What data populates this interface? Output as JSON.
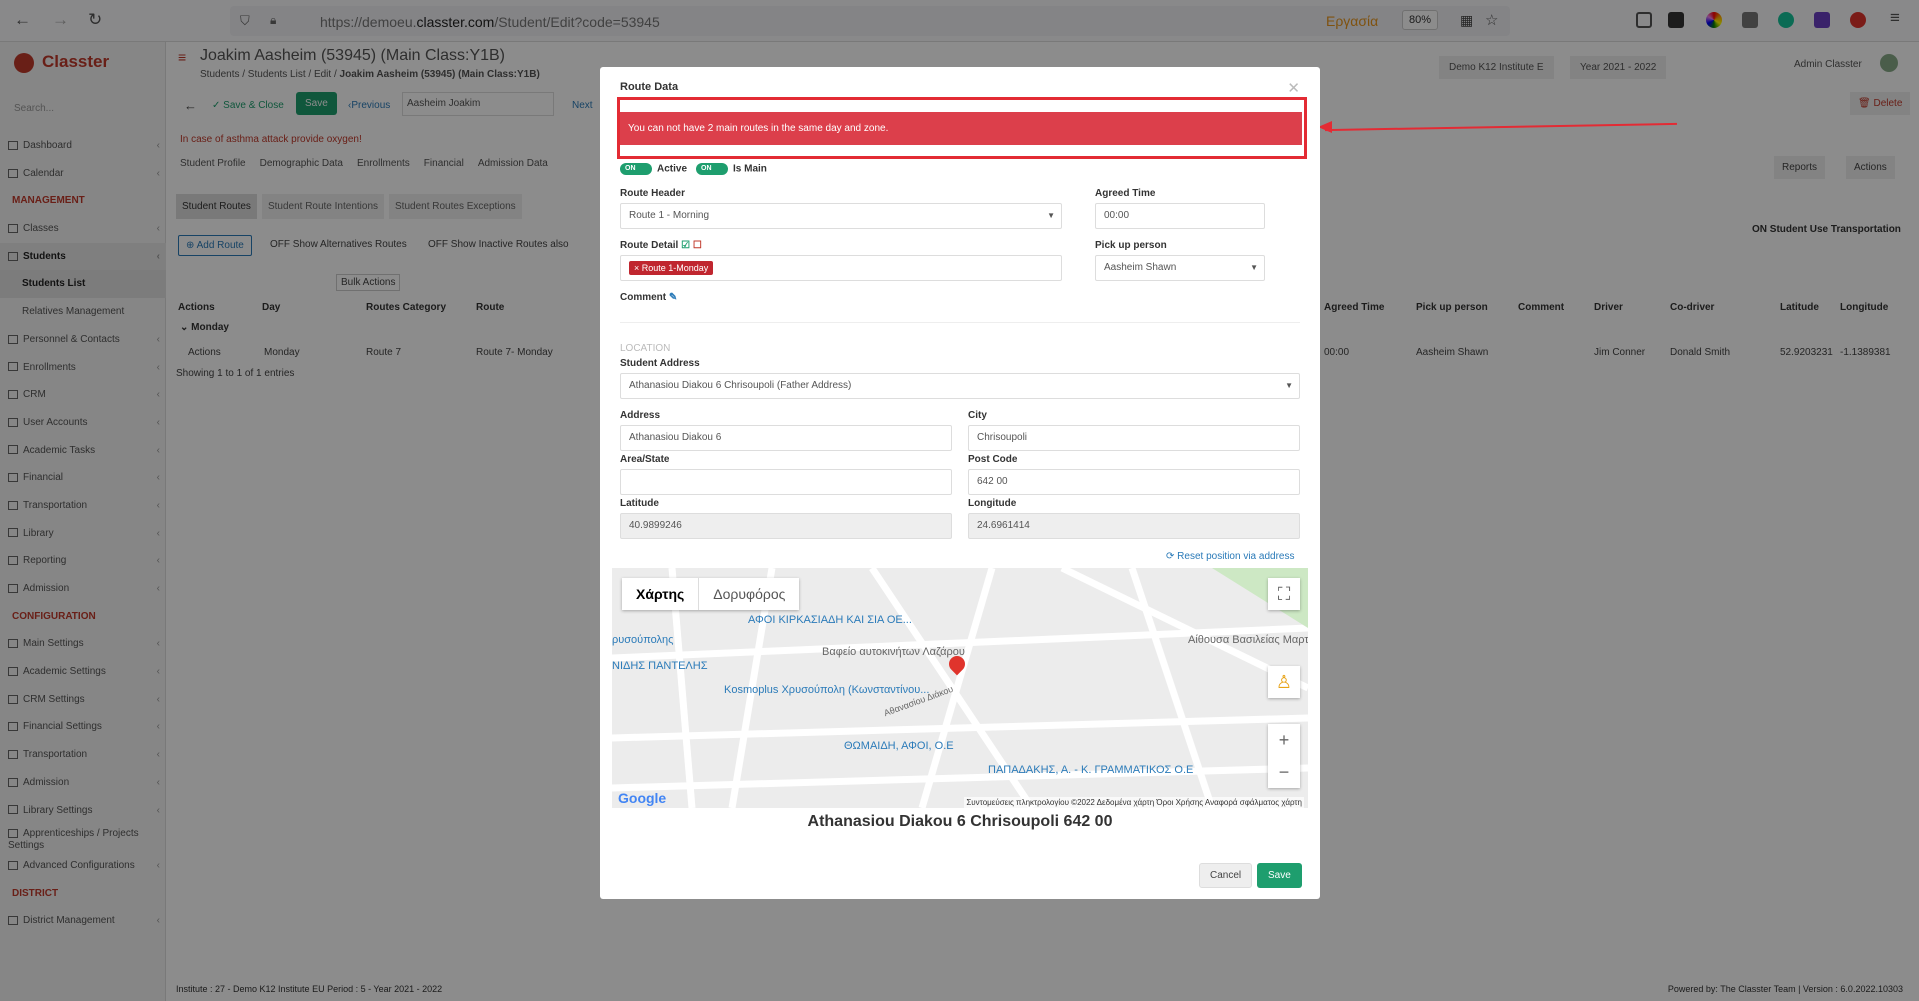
{
  "browser": {
    "url_prefix": "https://demoeu.",
    "url_domain": "classter.com",
    "url_path": "/Student/Edit?code=53945",
    "container": "Εργασία",
    "zoom": "80%"
  },
  "app": {
    "logo": "Classter",
    "search_placeholder": "Search..."
  },
  "nav": [
    {
      "label": "Dashboard",
      "type": "item"
    },
    {
      "label": "Calendar",
      "type": "item"
    },
    {
      "label": "MANAGEMENT",
      "type": "sec"
    },
    {
      "label": "Classes",
      "type": "item"
    },
    {
      "label": "Students",
      "type": "act"
    },
    {
      "label": "Students List",
      "type": "subact"
    },
    {
      "label": "Relatives Management",
      "type": "sub"
    },
    {
      "label": "Personnel & Contacts",
      "type": "item"
    },
    {
      "label": "Enrollments",
      "type": "item"
    },
    {
      "label": "CRM",
      "type": "item"
    },
    {
      "label": "User Accounts",
      "type": "item"
    },
    {
      "label": "Academic Tasks",
      "type": "item"
    },
    {
      "label": "Financial",
      "type": "item"
    },
    {
      "label": "Transportation",
      "type": "item"
    },
    {
      "label": "Library",
      "type": "item"
    },
    {
      "label": "Reporting",
      "type": "item"
    },
    {
      "label": "Admission",
      "type": "item"
    },
    {
      "label": "CONFIGURATION",
      "type": "sec"
    },
    {
      "label": "Main Settings",
      "type": "item"
    },
    {
      "label": "Academic Settings",
      "type": "item"
    },
    {
      "label": "CRM Settings",
      "type": "item"
    },
    {
      "label": "Financial Settings",
      "type": "item"
    },
    {
      "label": "Transportation",
      "type": "item"
    },
    {
      "label": "Admission",
      "type": "item"
    },
    {
      "label": "Library Settings",
      "type": "item"
    },
    {
      "label": "Apprenticeships / Projects Settings",
      "type": "wrap"
    },
    {
      "label": "Advanced Configurations",
      "type": "item"
    },
    {
      "label": "DISTRICT",
      "type": "sec"
    },
    {
      "label": "District Management",
      "type": "item"
    }
  ],
  "header": {
    "title": "Joakim Aasheim (53945) (Main Class:Y1B)",
    "crumbs": "Students / Students List / Edit /",
    "crumb_current": "Joakim Aasheim (53945) (Main Class:Y1B)",
    "institute": "Demo K12 Institute E",
    "year": "Year 2021 - 2022",
    "admin": "Admin Classter"
  },
  "toolbar": {
    "save_close": "Save & Close",
    "save": "Save",
    "previous": "Previous",
    "student": "Aasheim Joakim",
    "next": "Next",
    "delete": "Delete",
    "reports": "Reports",
    "actions": "Actions"
  },
  "asthma": "In case of asthma attack provide oxygen!",
  "tabs": [
    "Student Profile",
    "Demographic Data",
    "Enrollments",
    "Financial",
    "Admission Data"
  ],
  "subtabs": [
    "Student Routes",
    "Student Route Intentions",
    "Student Routes Exceptions"
  ],
  "route_tools": {
    "add_route": "Add Route",
    "show_alt": "Show Alternatives Routes",
    "show_inactive": "Show Inactive Routes also",
    "bulk": "Bulk Actions",
    "use_transport": "Student Use Transportation",
    "off": "OFF",
    "on": "ON"
  },
  "table": {
    "left_headers": [
      "Actions",
      "Day",
      "Routes Category",
      "Route"
    ],
    "right_headers": [
      "Agreed Time",
      "Pick up person",
      "Comment",
      "Driver",
      "Co-driver",
      "Latitude",
      "Longitude"
    ],
    "group": "Monday",
    "row": {
      "actions": "Actions",
      "day": "Monday",
      "category": "Route 7",
      "route": "Route 7- Monday",
      "agreed": "00:00",
      "pickup": "Aasheim Shawn",
      "driver": "Jim Conner",
      "codriver": "Donald Smith",
      "lat": "52.9203231",
      "lng": "-1.1389381"
    },
    "showing": "Showing 1 to 1 of 1 entries"
  },
  "modal": {
    "title": "Route Data",
    "error": "You can not have 2 main routes in the same day and zone.",
    "active": "Active",
    "is_main": "Is Main",
    "on": "ON",
    "route_header_label": "Route Header",
    "route_header": "Route 1 - Morning",
    "agreed_label": "Agreed Time",
    "agreed": "00:00",
    "route_detail_label": "Route Detail",
    "route_detail_chip": "Route 1-Monday",
    "pickup_label": "Pick up person",
    "pickup": "Aasheim Shawn",
    "comment_label": "Comment",
    "location": "LOCATION",
    "student_address_label": "Student Address",
    "student_address": "Athanasiou Diakou 6 Chrisoupoli (Father Address)",
    "address_label": "Address",
    "address": "Athanasiou Diakou 6",
    "city_label": "City",
    "city": "Chrisoupoli",
    "area_label": "Area/State",
    "area": "",
    "post_label": "Post Code",
    "post": "642 00",
    "lat_label": "Latitude",
    "lat": "40.9899246",
    "lng_label": "Longitude",
    "lng": "24.6961414",
    "reset": "Reset position via address",
    "map_type_map": "Χάρτης",
    "map_type_sat": "Δορυφόρος",
    "map_labels": [
      "ΑΦΟΙ ΚΙΡΚΑΣΙΑΔΗ ΚΑΙ ΣΙΑ ΟΕ...",
      "Βαφείο αυτοκινήτων Λαζάρου",
      "Kosmoplus Χρυσούπολη (Κωνσταντίνου...",
      "ΘΩΜΑΙΔΗ, ΑΦΟΙ, Ο.Ε",
      "ΠΑΠΑΔΑΚΗΣ, Α. - Κ. ΓΡΑΜΜΑΤΙΚΟΣ Ο.Ε",
      "Αίθουσα Βασιλείας Μαρτύρων του Ιε",
      "ΝΙΔΗΣ ΠΑΝΤΕΛΗΣ",
      "ρυσούπολης",
      "Αθανασίου Διάκου"
    ],
    "map_footer": "Συντομεύσεις πληκτρολογίου   ©2022 Δεδομένα χάρτη   Όροι Χρήσης   Αναφορά σφάλματος χάρτη",
    "google": "Google",
    "full_address": "Athanasiou Diakou 6 Chrisoupoli 642 00",
    "cancel": "Cancel",
    "save": "Save"
  },
  "footer": {
    "left": "Institute : 27 - Demo K12 Institute EU  Period : 5 - Year 2021 - 2022",
    "right": "Powered by: The Classter Team  | Version : 6.0.2022.10303"
  }
}
